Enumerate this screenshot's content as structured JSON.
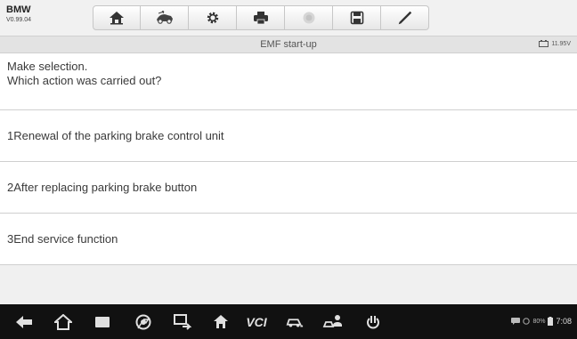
{
  "header": {
    "brand": "BMW",
    "version": "V0.99.04",
    "toolbar_icons": [
      "home-icon",
      "vehicle-swap-icon",
      "settings-icon",
      "print-icon",
      "help-icon",
      "save-icon",
      "edit-icon"
    ]
  },
  "titlebar": {
    "title": "EMF start-up",
    "battery_voltage": "11.95V"
  },
  "prompt": {
    "line1": "Make selection.",
    "line2": "Which action was carried out?"
  },
  "options": [
    {
      "label": "1Renewal of the parking brake control unit"
    },
    {
      "label": "2After replacing parking brake button"
    },
    {
      "label": "3End service function"
    }
  ],
  "navbar": {
    "icons": [
      "back-icon",
      "home-icon",
      "recent-apps-icon",
      "chrome-icon",
      "screen-cast-icon",
      "maxisys-home-icon",
      "vci-icon",
      "car-shortcut-icon",
      "remote-desk-icon",
      "power-icon"
    ],
    "vci_label": "VCI",
    "battery": "80%",
    "time": "7:08"
  }
}
